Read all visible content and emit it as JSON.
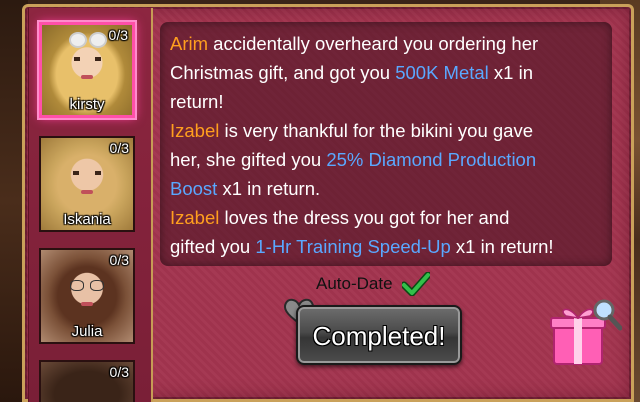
{
  "portraits": [
    {
      "name": "kirsty",
      "count": "0/3",
      "selected": true
    },
    {
      "name": "Iskania",
      "count": "0/3",
      "selected": false
    },
    {
      "name": "Julia",
      "count": "0/3",
      "selected": false
    },
    {
      "name": "",
      "count": "0/3",
      "selected": false
    }
  ],
  "messages": [
    {
      "line1_name": "Arim",
      "line1_text": " accidentally overheard you ordering her",
      "line2_text": "Christmas gift, and got you ",
      "item": "500K Metal",
      "after_item": " x1 in",
      "line3_text": "return!"
    },
    {
      "line1_name": "Izabel",
      "line1_text": " is very thankful for the bikini you gave",
      "line2_text": "her, she gifted you ",
      "item_part1": "25% Diamond Production",
      "item_part2": "Boost",
      "after_item": " x1 in return."
    },
    {
      "line1_name": "Izabel",
      "line1_text": " loves the dress you got for her and",
      "line2_text": "gifted you ",
      "item": "1-Hr Training Speed-Up",
      "after_item": " x1 in return!"
    }
  ],
  "auto_date_label": "Auto-Date",
  "completed_label": "Completed!",
  "colors": {
    "panel": "#a3344f",
    "name_highlight": "#ff9f1e",
    "item_highlight": "#5aa8ff",
    "selected_border": "#ff4fa8"
  },
  "icons": [
    "check-icon",
    "heart-icon",
    "gift-icon",
    "sunglasses-icon",
    "glasses-icon"
  ]
}
